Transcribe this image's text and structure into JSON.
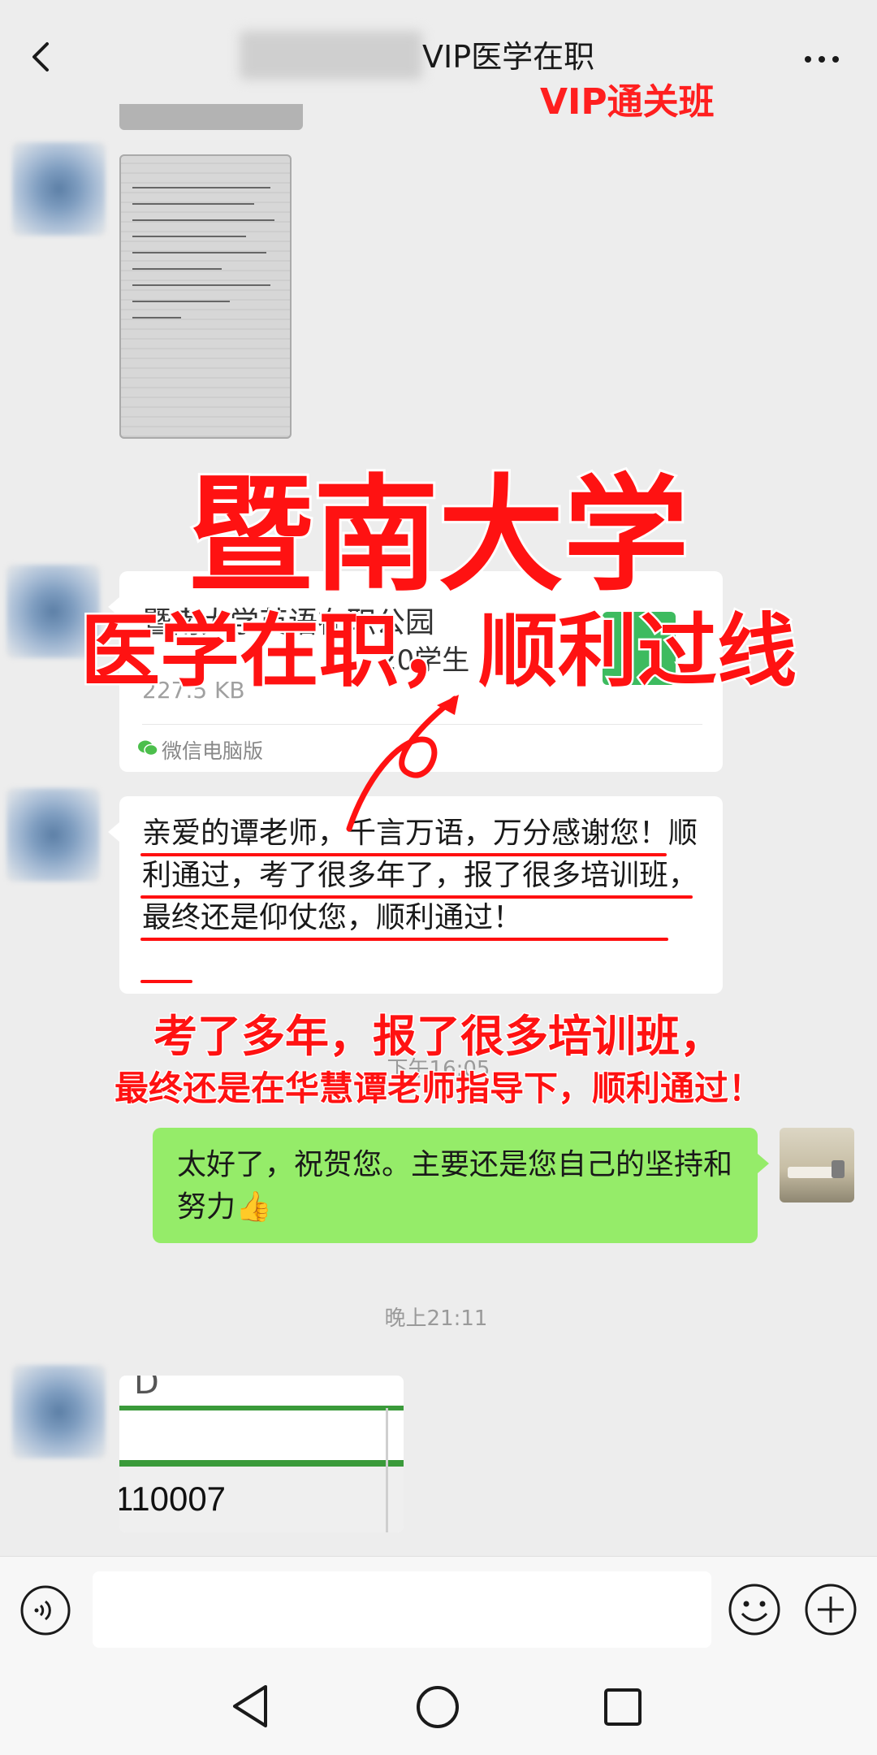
{
  "header": {
    "title": "VIP医学在职",
    "tag": "VIP通关班"
  },
  "messages": {
    "file": {
      "name": "暨南大学英语在职公园",
      "name_suffix": "20学生",
      "size": "227.5 KB",
      "source": "微信电脑版"
    },
    "received_text": "亲爱的谭老师，千言万语，万分感谢您！顺利通过，考了很多年了，报了很多培训班，最终还是仰仗您，顺利通过！",
    "time_1": "下午16:05",
    "sent_text": "太好了，祝贺您。主要还是您自己的坚持和努力👍",
    "time_2": "晚上21:11",
    "table_snippet": {
      "col_letter": "D",
      "value": "110007"
    }
  },
  "overlay": {
    "headline": "暨南大学",
    "subheadline": "医学在职，顺利过线",
    "caption_1": "考了多年，报了很多培训班，",
    "caption_2": "最终还是在华慧谭老师指导下，顺利通过！"
  },
  "colors": {
    "background": "#ededed",
    "sent_bubble": "#95ec69",
    "overlay_red": "#ff1212"
  },
  "icons": [
    "back-icon",
    "more-icon",
    "wechat-icon",
    "voice-icon",
    "emoji-icon",
    "plus-icon",
    "nav-back-icon",
    "nav-home-icon",
    "nav-recent-icon"
  ]
}
